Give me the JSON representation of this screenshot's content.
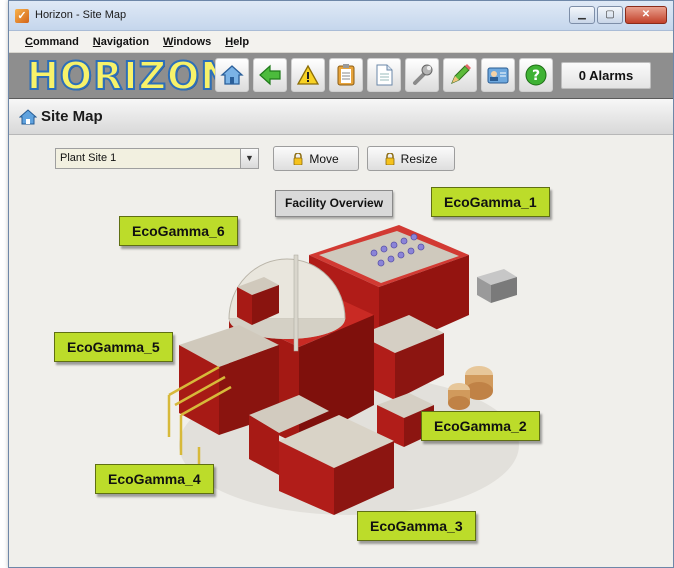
{
  "window": {
    "title": "Horizon - Site Map"
  },
  "menu": [
    {
      "label": "Command",
      "accel": "C"
    },
    {
      "label": "Navigation",
      "accel": "N"
    },
    {
      "label": "Windows",
      "accel": "W"
    },
    {
      "label": "Help",
      "accel": "H"
    }
  ],
  "toolbar": {
    "logo": "HORIZON",
    "alarms_label": "0 Alarms",
    "tools": [
      "home-icon",
      "back-arrow-icon",
      "warning-icon",
      "clipboard-icon",
      "document-icon",
      "wrench-icon",
      "pencil-icon",
      "user-card-icon",
      "help-icon"
    ]
  },
  "page": {
    "title": "Site Map"
  },
  "site_select": {
    "value": "Plant Site 1"
  },
  "buttons": {
    "move": "Move",
    "resize": "Resize"
  },
  "map": {
    "overview_label": "Facility Overview",
    "tags": [
      "EcoGamma_1",
      "EcoGamma_2",
      "EcoGamma_3",
      "EcoGamma_4",
      "EcoGamma_5",
      "EcoGamma_6"
    ]
  },
  "colors": {
    "tag_green": "#bcdc2a",
    "building_red": "#c2201c",
    "toolbar_gray": "#8e8e8e"
  }
}
